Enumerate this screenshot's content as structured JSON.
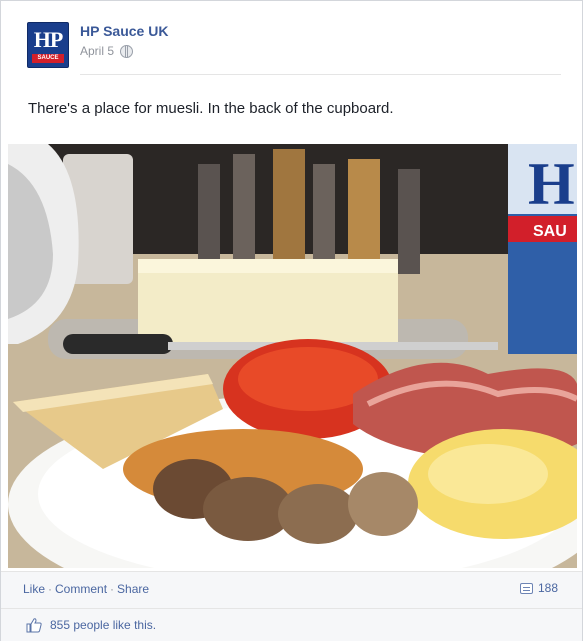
{
  "post": {
    "page_name": "HP Sauce UK",
    "date": "April 5",
    "privacy_icon": "globe-icon",
    "text": "There's a place for muesli. In the back of the cupboard."
  },
  "logo": {
    "text": "HP",
    "strip_text": "SAUCE",
    "color": "#1a3e8c",
    "accent": "#d21f2a"
  },
  "photo": {
    "bottle_label": "H",
    "bottle_strip": "SAU"
  },
  "actions": {
    "like": "Like",
    "comment": "Comment",
    "share": "Share",
    "separator": "·",
    "share_count": "188"
  },
  "likes": {
    "text": "855 people like this.",
    "icon": "thumbs-up-icon"
  },
  "colors": {
    "link": "#3b5998",
    "muted": "#90949c",
    "bar_bg": "#f6f7f9"
  }
}
